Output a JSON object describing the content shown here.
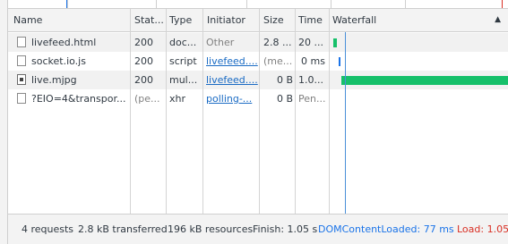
{
  "columns": {
    "name": "Name",
    "status": "Stat...",
    "type": "Type",
    "initiator": "Initiator",
    "size": "Size",
    "time": "Time",
    "waterfall": "Waterfall"
  },
  "requests": [
    {
      "name": "livefeed.html",
      "status": "200",
      "type": "doc...",
      "initiator": "Other",
      "size": "2.8 ...",
      "time": "20 ...",
      "icon": "document-icon"
    },
    {
      "name": "socket.io.js",
      "status": "200",
      "type": "script",
      "initiator": "livefeed....",
      "size": "(me...",
      "time": "0 ms",
      "icon": "document-icon"
    },
    {
      "name": "live.mjpg",
      "status": "200",
      "type": "mul...",
      "initiator": "livefeed....",
      "size": "0 B",
      "time": "1.0...",
      "icon": "image-icon"
    },
    {
      "name": "?EIO=4&transpor...",
      "status": "(pe...",
      "type": "xhr",
      "initiator": "polling-...",
      "size": "0 B",
      "time": "Pen...",
      "icon": "document-icon"
    }
  ],
  "summary": {
    "requests": "4 requests",
    "transferred": "2.8 kB transferred",
    "resources": "196 kB resources",
    "finish": "Finish: 1.05 s",
    "dom_content_loaded": "DOMContentLoaded: 77 ms",
    "load": "Load: 1.05"
  },
  "colors": {
    "waterfall_bar": "#16c06a",
    "dcl_line": "#4a90d9",
    "link": "#1a6bc4",
    "load": "#d93025"
  }
}
